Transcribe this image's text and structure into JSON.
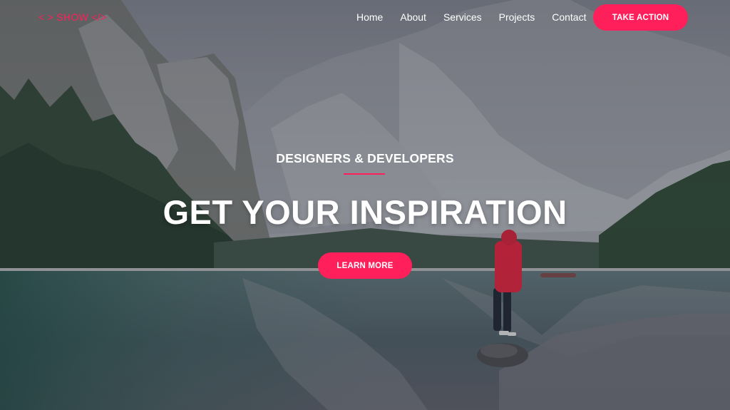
{
  "navbar": {
    "logo": "< > SHOW </>",
    "links": [
      "Home",
      "About",
      "Services",
      "Projects",
      "Contact"
    ],
    "cta": "TAKE ACTION"
  },
  "hero": {
    "subtitle": "DESIGNERS & DEVELOPERS",
    "headline": "GET YOUR INSPIRATION",
    "cta": "LEARN MORE"
  },
  "colors": {
    "accent": "#ff1f5a",
    "text": "#ffffff"
  }
}
